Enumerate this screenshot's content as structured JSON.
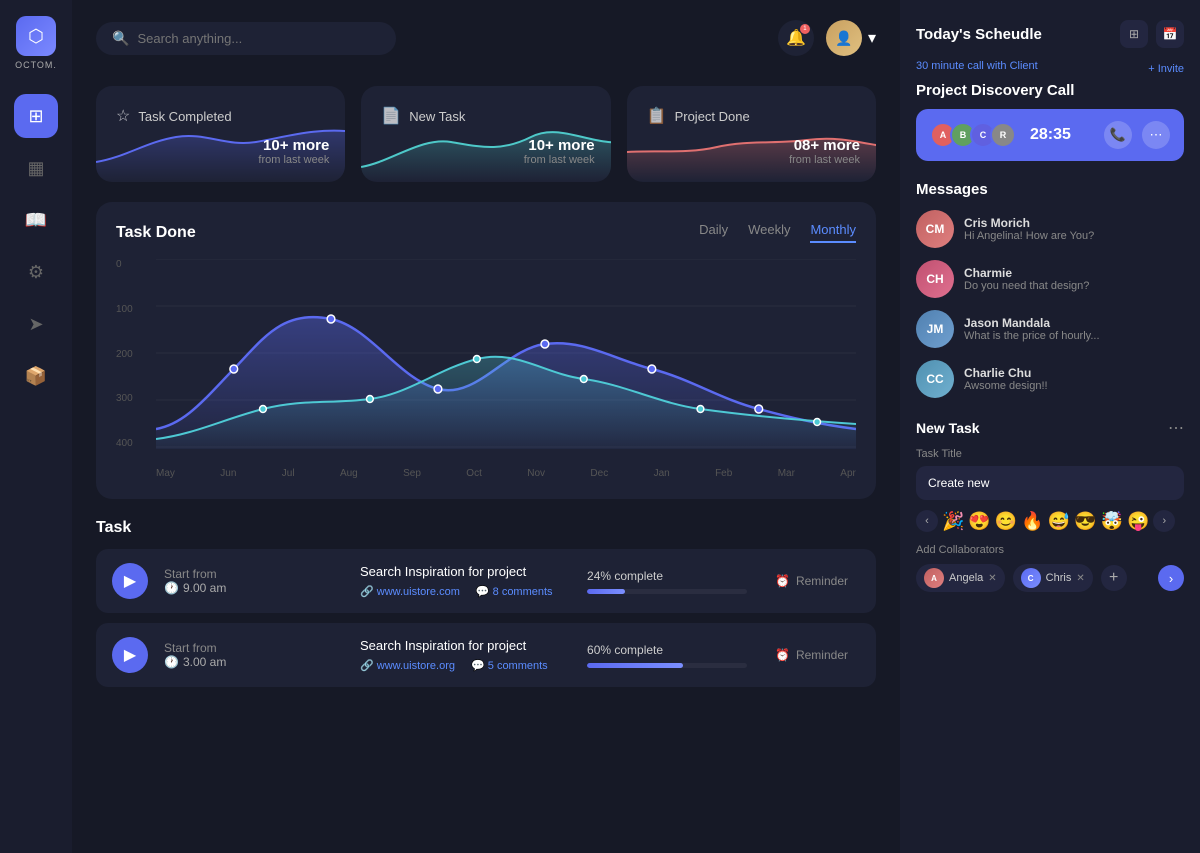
{
  "app": {
    "name": "OCTOM.",
    "logo_letter": "⬡"
  },
  "header": {
    "search_placeholder": "Search anything...",
    "notification_count": "1"
  },
  "sidebar": {
    "items": [
      {
        "id": "dashboard",
        "icon": "⊞",
        "active": true
      },
      {
        "id": "layout",
        "icon": "▦"
      },
      {
        "id": "book",
        "icon": "📖"
      },
      {
        "id": "settings",
        "icon": "⚙"
      },
      {
        "id": "send",
        "icon": "➤"
      },
      {
        "id": "box",
        "icon": "📦"
      }
    ]
  },
  "stat_cards": [
    {
      "id": "task-completed",
      "icon": "☆",
      "title": "Task Completed",
      "value": "10+ more",
      "sub": "from last week",
      "color": "#5b6af0"
    },
    {
      "id": "new-task",
      "icon": "📄",
      "title": "New Task",
      "value": "10+ more",
      "sub": "from last week",
      "color": "#4ec9c9"
    },
    {
      "id": "project-done",
      "icon": "📋",
      "title": "Project Done",
      "value": "08+ more",
      "sub": "from last week",
      "color": "#e07070"
    }
  ],
  "chart": {
    "title": "Task Done",
    "tabs": [
      "Daily",
      "Weekly",
      "Monthly"
    ],
    "active_tab": "Monthly",
    "y_axis": [
      "0",
      "100",
      "200",
      "300",
      "400"
    ],
    "x_axis": [
      "May",
      "Jun",
      "Jul",
      "Aug",
      "Sep",
      "Oct",
      "Nov",
      "Dec",
      "Jan",
      "Feb",
      "Mar",
      "Apr"
    ]
  },
  "tasks": {
    "title": "Task",
    "items": [
      {
        "id": "task-1",
        "start_label": "Start from",
        "time": "9.00 am",
        "name": "Search Inspiration for project",
        "link": "www.uistore.com",
        "comments": "8 comments",
        "progress_label": "24% complete",
        "progress_pct": 24,
        "reminder": "Reminder"
      },
      {
        "id": "task-2",
        "start_label": "Start from",
        "time": "3.00 am",
        "name": "Search Inspiration for project",
        "link": "www.uistore.org",
        "comments": "5 comments",
        "progress_label": "60% complete",
        "progress_pct": 60,
        "reminder": "Reminder"
      }
    ]
  },
  "right_panel": {
    "schedule": {
      "title": "Today's Scheudle",
      "sub_text": "30 minute call with",
      "sub_client": "Client",
      "invite_label": "+ Invite",
      "event_title": "Project Discovery Call",
      "call_timer": "28:35",
      "call_avatars": [
        "A",
        "B",
        "C",
        "R"
      ]
    },
    "messages": {
      "title": "Messages",
      "items": [
        {
          "name": "Cris Morich",
          "text": "Hi Angelina! How are You?",
          "color": "#c06060"
        },
        {
          "name": "Charmie",
          "text": "Do you need that design?",
          "color": "#c06080"
        },
        {
          "name": "Jason Mandala",
          "text": "What is the price of hourly...",
          "color": "#6090c0"
        },
        {
          "name": "Charlie Chu",
          "text": "Awsome design!!",
          "color": "#60a0c0"
        }
      ]
    },
    "new_task": {
      "title": "New Task",
      "field_label": "Task Title",
      "input_value": "Create new",
      "emojis": [
        "🎉",
        "😍",
        "😊",
        "🔥",
        "😅",
        "😎",
        "🤯",
        "😜"
      ],
      "collab_label": "Add Collaborators",
      "collaborators": [
        {
          "name": "Angela",
          "color": "#c06060"
        },
        {
          "name": "Chris",
          "color": "#5b6af0"
        }
      ]
    }
  }
}
